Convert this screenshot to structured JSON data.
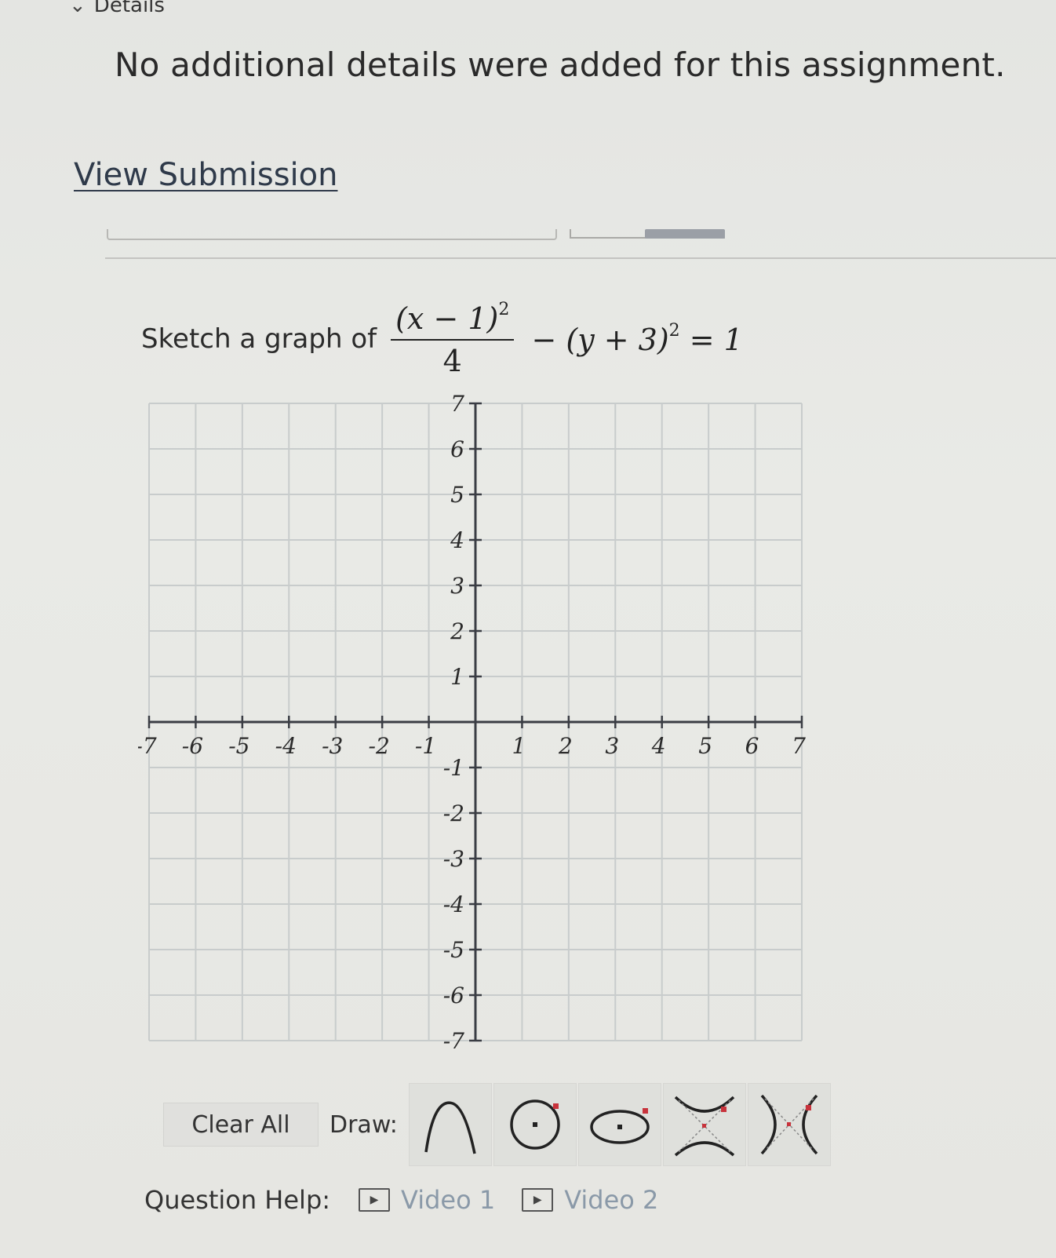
{
  "details": {
    "chevron_icon": "chevron-down-icon",
    "label": "Details"
  },
  "no_details_text": "No additional details were added for this assignment.",
  "view_submission": "View Submission",
  "question": {
    "prefix": "Sketch a graph of",
    "numerator": "(x − 1)",
    "numerator_exp": "2",
    "denominator": "4",
    "rest_a": " − (y + 3)",
    "rest_exp": "2",
    "rest_b": " = 1"
  },
  "chart_data": {
    "type": "scatter",
    "xlim": [
      -7,
      7
    ],
    "ylim": [
      -7,
      7
    ],
    "grid": true,
    "x_ticks": [
      "-7",
      "-6",
      "-5",
      "-4",
      "-3",
      "-2",
      "-1",
      "1",
      "2",
      "3",
      "4",
      "5",
      "6",
      "7"
    ],
    "y_ticks": [
      "7",
      "6",
      "5",
      "4",
      "3",
      "2",
      "1",
      "-1",
      "-2",
      "-3",
      "-4",
      "-5",
      "-6",
      "-7"
    ],
    "x_tick_values": [
      -7,
      -6,
      -5,
      -4,
      -3,
      -2,
      -1,
      1,
      2,
      3,
      4,
      5,
      6,
      7
    ],
    "y_tick_values": [
      7,
      6,
      5,
      4,
      3,
      2,
      1,
      -1,
      -2,
      -3,
      -4,
      -5,
      -6,
      -7
    ]
  },
  "toolbar": {
    "clear_all": "Clear All",
    "draw_label": "Draw:",
    "tools": [
      "parabola-tool-icon",
      "circle-tool-icon",
      "ellipse-tool-icon",
      "vertical-hyperbola-tool-icon",
      "horizontal-hyperbola-tool-icon"
    ]
  },
  "help": {
    "label": "Question Help:",
    "video1": "Video 1",
    "video2": "Video 2",
    "play_icon": "play-icon"
  },
  "colors": {
    "grid": "#c8cccc",
    "axis": "#3a3d44",
    "link": "#2f3a4a",
    "video_link": "#8a99a8"
  }
}
